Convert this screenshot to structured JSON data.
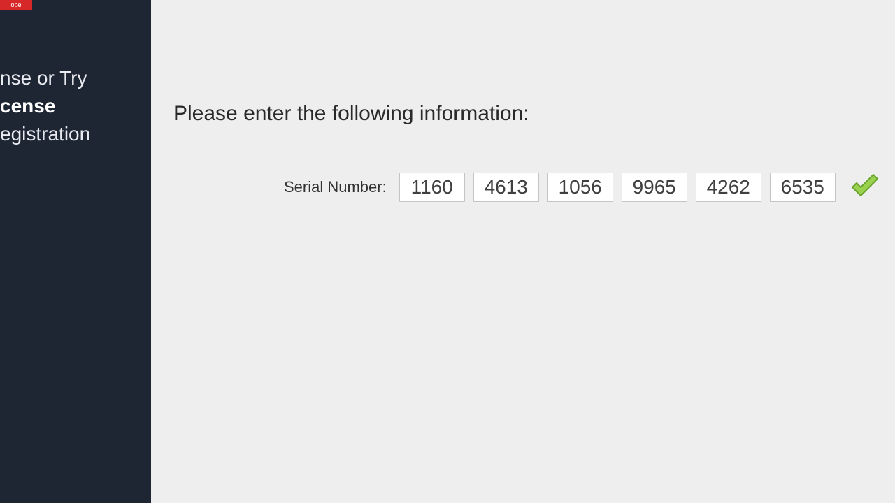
{
  "brand": {
    "logo_text": "obe"
  },
  "sidebar": {
    "items": [
      {
        "label": "nse or Try",
        "active": false
      },
      {
        "label": "cense",
        "active": true
      },
      {
        "label": "egistration",
        "active": false
      }
    ]
  },
  "main": {
    "prompt": "Please enter the following information:",
    "serial_label": "Serial Number:",
    "serial_parts": [
      "1160",
      "4613",
      "1056",
      "9965",
      "4262",
      "6535"
    ],
    "valid": true
  }
}
